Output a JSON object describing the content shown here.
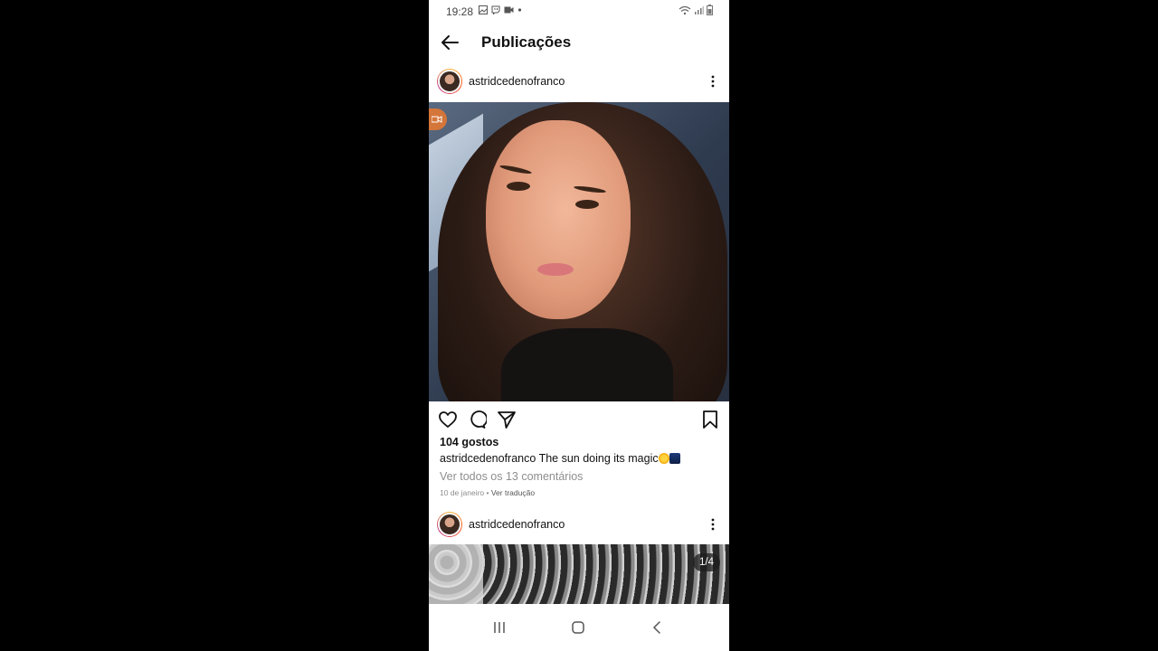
{
  "status_bar": {
    "time": "19:28"
  },
  "header": {
    "title": "Publicações"
  },
  "post1": {
    "username": "astridcedenofranco",
    "likes": "104 gostos",
    "caption_user": "astridcedenofranco",
    "caption_text": "The sun doing its magic",
    "view_comments": "Ver todos os 13 comentários",
    "date": "10 de janeiro",
    "separator": " • ",
    "translate": "Ver tradução"
  },
  "post2": {
    "username": "astridcedenofranco",
    "carousel_counter": "1/4"
  },
  "colors": {
    "background": "#000000",
    "app_bg": "#ffffff",
    "text": "#111111",
    "muted": "#8e8e8e",
    "story_ring": "#c13584"
  },
  "icons": [
    "back-arrow-icon",
    "more-vertical-icon",
    "heart-icon",
    "comment-icon",
    "share-icon",
    "bookmark-icon",
    "recents-icon",
    "home-icon",
    "nav-back-icon"
  ]
}
